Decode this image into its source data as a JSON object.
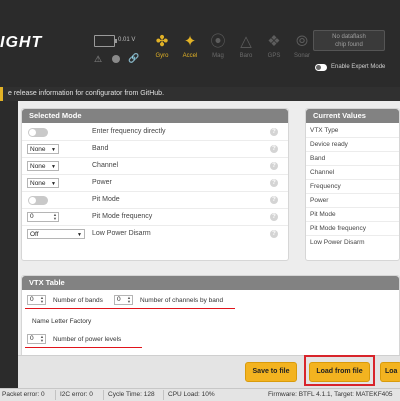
{
  "header": {
    "logo_text": "IGHT",
    "voltage": "0.01 V",
    "sensors": [
      {
        "label": "Gyro",
        "icon": "gyro-icon",
        "active": true
      },
      {
        "label": "Accel",
        "icon": "accel-icon",
        "active": true
      },
      {
        "label": "Mag",
        "icon": "mag-icon",
        "active": false
      },
      {
        "label": "Baro",
        "icon": "baro-icon",
        "active": false
      },
      {
        "label": "GPS",
        "icon": "gps-icon",
        "active": false
      },
      {
        "label": "Sonar",
        "icon": "sonar-icon",
        "active": false
      }
    ],
    "dataflash_line1": "No dataflash",
    "dataflash_line2": "chip found",
    "expert_mode_label": "Enable Expert Mode"
  },
  "notice": {
    "text": "e release information for configurator from GitHub."
  },
  "selected_mode": {
    "title": "Selected Mode",
    "rows": [
      {
        "control": "switch",
        "label": "Enter frequency directly"
      },
      {
        "control": "select",
        "value": "None",
        "label": "Band"
      },
      {
        "control": "select",
        "value": "None",
        "label": "Channel"
      },
      {
        "control": "select",
        "value": "None",
        "label": "Power"
      },
      {
        "control": "switch",
        "label": "Pit Mode"
      },
      {
        "control": "number",
        "value": "0",
        "label": "Pit Mode frequency"
      },
      {
        "control": "select",
        "value": "Off",
        "label": "Low Power Disarm"
      }
    ],
    "help_glyph": "?"
  },
  "current_values": {
    "title": "Current Values",
    "rows": [
      "VTX Type",
      "Device ready",
      "Band",
      "Channel",
      "Frequency",
      "Power",
      "Pit Mode",
      "Pit Mode frequency",
      "Low Power Disarm"
    ]
  },
  "vtx_table": {
    "title": "VTX Table",
    "bands_value": "0",
    "bands_label": "Number of bands",
    "channels_value": "0",
    "channels_label": "Number of channels by band",
    "name_letter_factory_label": "Name Letter Factory",
    "power_levels_value": "0",
    "power_levels_label": "Number of power levels"
  },
  "toolbar": {
    "save_label": "Save to file",
    "load_label": "Load from file",
    "extra_label": "Loa"
  },
  "status_bar": {
    "packet_error": "Packet error: 0",
    "i2c_error": "I2C error: 0",
    "cycle_time": "Cycle Time: 128",
    "cpu_load": "CPU Load: 10%",
    "firmware": "Firmware: BTFL 4.1.1, Target: MATEKF405"
  },
  "colors": {
    "accent": "#f3b320",
    "highlight_red": "#e0141b",
    "header_bg": "#2b2b2b"
  }
}
